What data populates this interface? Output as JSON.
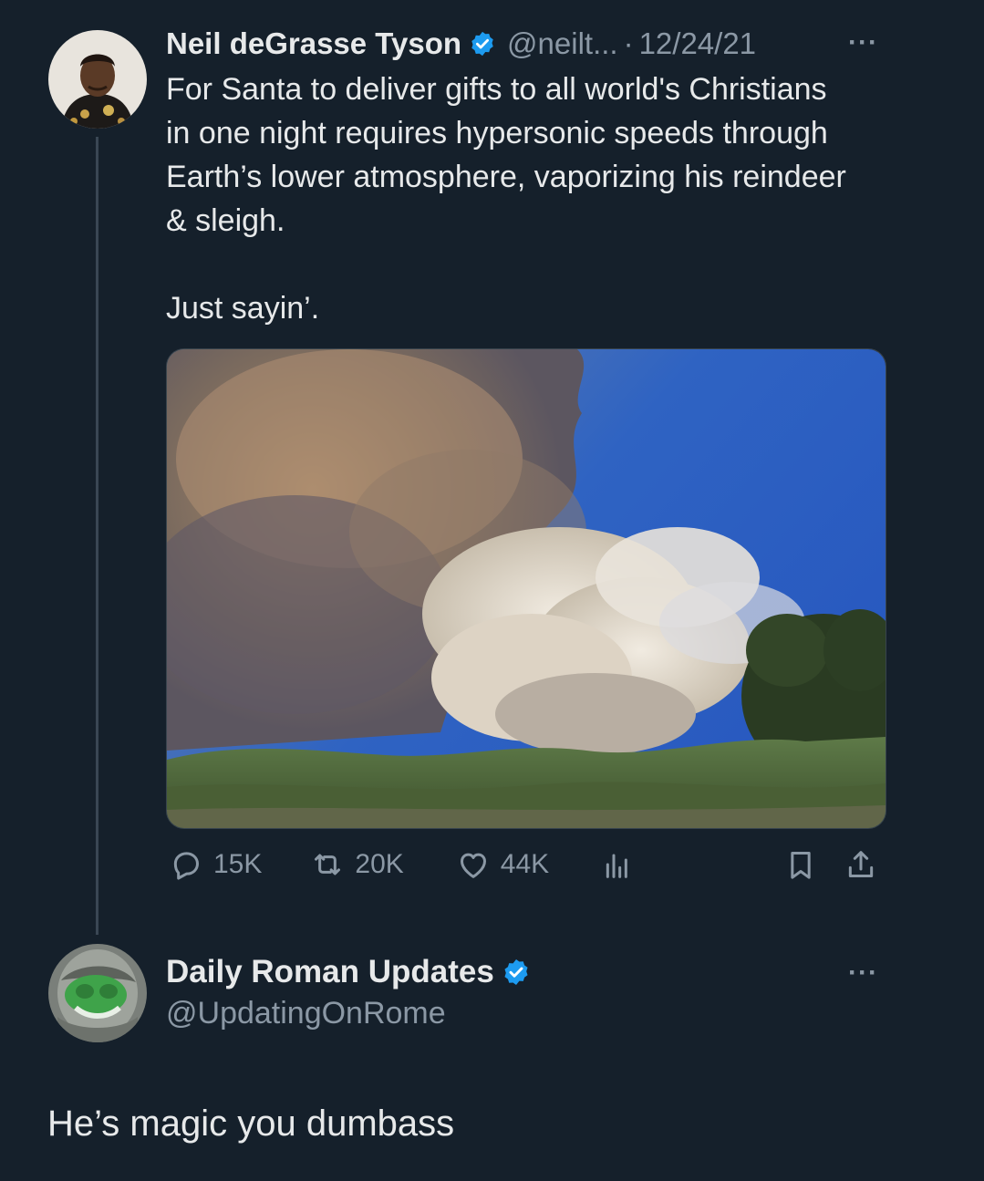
{
  "tweet": {
    "author_name": "Neil deGrasse Tyson",
    "author_handle": "@neilt...",
    "separator": "·",
    "date": "12/24/21",
    "text_para1": "For Santa to deliver gifts to all world's Christians in one night requires hypersonic speeds through Earth’s lower atmosphere, vaporizing his reindeer & sleigh.",
    "text_para2": "Just sayin’.",
    "more_label": "···",
    "stats": {
      "replies": "15K",
      "retweets": "20K",
      "likes": "44K"
    }
  },
  "reply": {
    "author_name": "Daily Roman Updates",
    "author_handle": "@UpdatingOnRome",
    "text": "He’s magic you dumbass",
    "more_label": "···"
  },
  "icons": {
    "verified": "verified-badge-icon",
    "reply": "reply-icon",
    "retweet": "retweet-icon",
    "like": "like-icon",
    "views": "views-icon",
    "bookmark": "bookmark-icon",
    "share": "share-icon"
  },
  "colors": {
    "background": "#15202b",
    "verified": "#1d9bf0",
    "secondary_text": "#8b98a5"
  }
}
